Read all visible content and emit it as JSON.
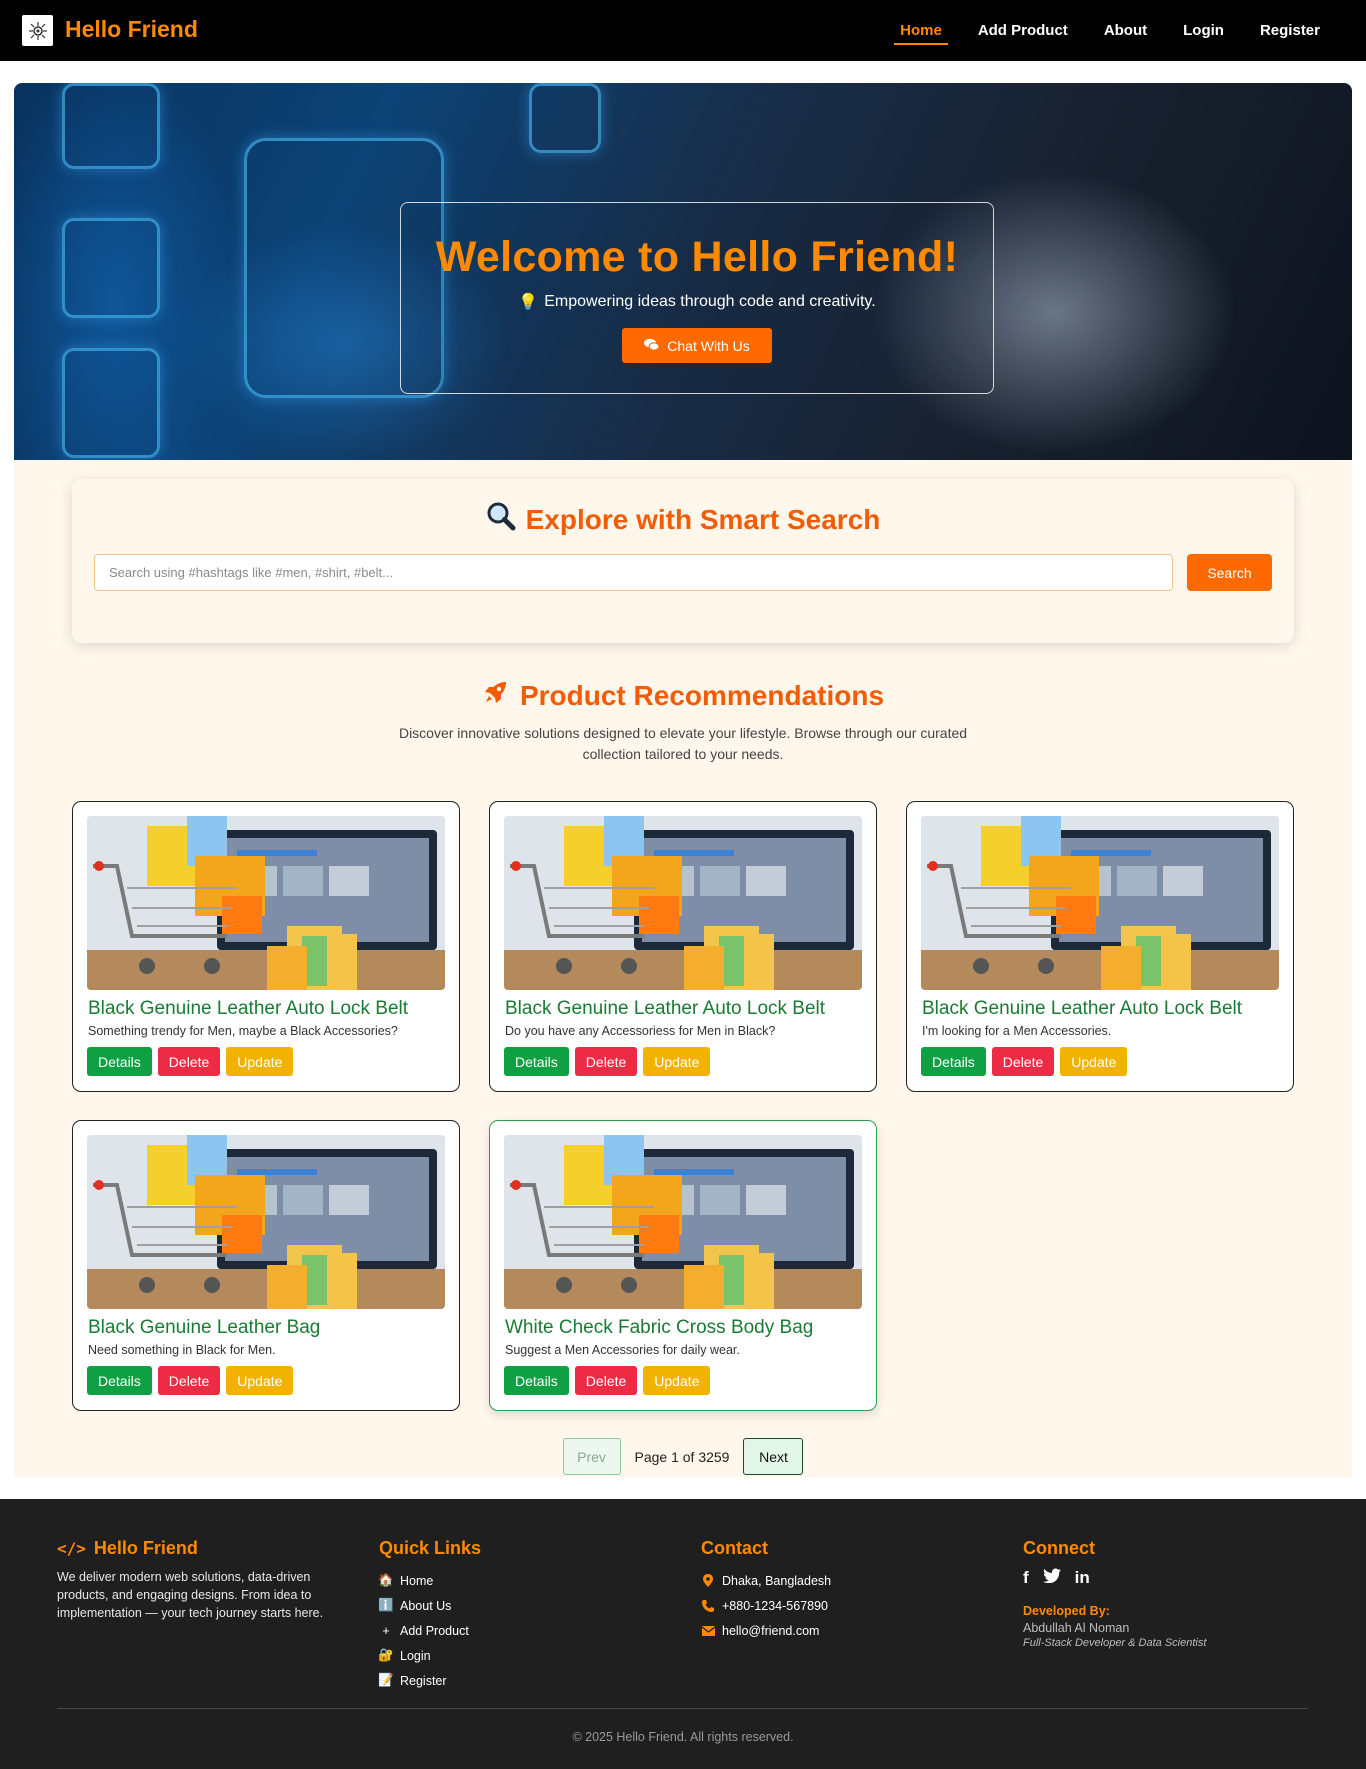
{
  "brand": {
    "name": "Hello Friend",
    "logo_icon": "robot-logo-icon"
  },
  "nav": {
    "items": [
      {
        "label": "Home",
        "active": true
      },
      {
        "label": "Add Product"
      },
      {
        "label": "About"
      },
      {
        "label": "Login"
      },
      {
        "label": "Register"
      }
    ]
  },
  "hero": {
    "title": "Welcome to Hello Friend!",
    "subtitle": "Empowering ideas through code and creativity.",
    "button_label": "Chat With Us"
  },
  "search": {
    "title": "Explore with Smart Search",
    "placeholder": "Search using #hashtags like #men, #shirt, #belt...",
    "value": "",
    "button_label": "Search"
  },
  "recommendations": {
    "title": "Product Recommendations",
    "description": "Discover innovative solutions designed to elevate your lifestyle. Browse through our curated collection tailored to your needs.",
    "products": [
      {
        "name": "Black Genuine Leather Auto Lock Belt",
        "description": "Something trendy for Men, maybe a Black Accessories?"
      },
      {
        "name": "Black Genuine Leather Auto Lock Belt",
        "description": "Do you have any Accessoriess for Men in Black?"
      },
      {
        "name": "Black Genuine Leather Auto Lock Belt",
        "description": "I'm looking for a Men Accessories."
      },
      {
        "name": "Black Genuine Leather Bag",
        "description": "Need something in Black for Men."
      },
      {
        "name": "White Check Fabric Cross Body Bag",
        "description": "Suggest a Men Accessories for daily wear."
      }
    ],
    "actions": {
      "details": "Details",
      "delete": "Delete",
      "update": "Update"
    }
  },
  "pagination": {
    "prev": "Prev",
    "info": "Page 1 of 3259",
    "next": "Next"
  },
  "footer": {
    "brand": "Hello Friend",
    "about": "We deliver modern web solutions, data-driven products, and engaging designs. From idea to implementation — your tech journey starts here.",
    "quick_links_title": "Quick Links",
    "quick_links": [
      "Home",
      "About Us",
      "Add Product",
      "Login",
      "Register"
    ],
    "contact_title": "Contact",
    "contact": {
      "address": "Dhaka, Bangladesh",
      "phone": "+880-1234-567890",
      "email": "hello@friend.com"
    },
    "connect_title": "Connect",
    "developed_by_label": "Developed By:",
    "developer_name": "Abdullah Al Noman",
    "developer_role": "Full-Stack Developer & Data Scientist",
    "copyright": "© 2025 Hello Friend. All rights reserved."
  },
  "colors": {
    "accent": "#ff8a00",
    "accent_deep": "#f25c05",
    "success": "#0fa044",
    "danger": "#ee2b45",
    "warning": "#f2b200",
    "product_title": "#1b7a33"
  }
}
